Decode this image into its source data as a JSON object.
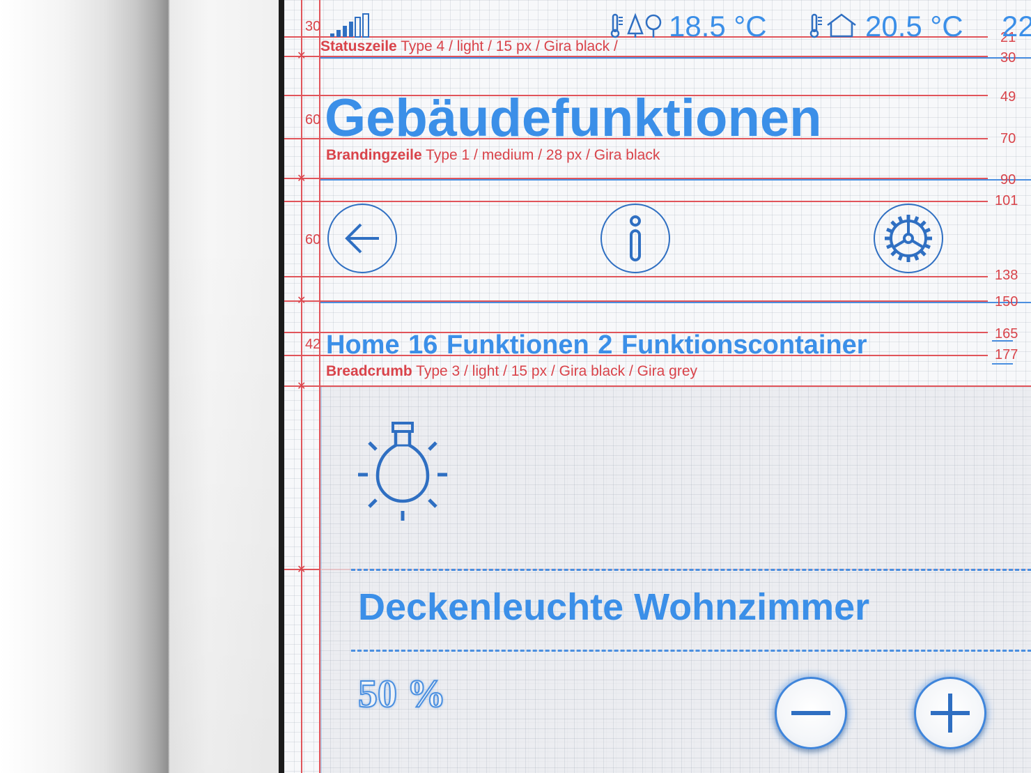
{
  "status_bar": {
    "height_label": "30",
    "outdoor_temp": "18.5 °C",
    "indoor_temp": "20.5 °C",
    "third_value": "22",
    "spec_bold": "Statuszeile",
    "spec_rest": "Type 4 / light / 15 px / Gira black /"
  },
  "branding": {
    "height_label": "60",
    "title": "Gebäudefunktionen",
    "spec_bold": "Brandingzeile",
    "spec_rest": "Type 1 / medium / 28 px / Gira black"
  },
  "nav": {
    "height_label": "60"
  },
  "breadcrumb": {
    "height_label": "42",
    "items": [
      "Home",
      "16 Funktionen",
      "2 Funktionscontainer"
    ],
    "spec_bold": "Breadcrumb",
    "spec_rest": "Type 3 / light / 15 px / Gira black / Gira grey"
  },
  "ruler": [
    "21",
    "30",
    "49",
    "70",
    "90",
    "101",
    "138",
    "150",
    "165",
    "177"
  ],
  "function_tile": {
    "name": "Deckenleuchte Wohnzimmer",
    "value": "50 %"
  },
  "icons": {
    "signal": "signal-strength-icon",
    "outdoor": "thermometer-outdoor-icon",
    "indoor": "thermometer-indoor-icon",
    "back": "arrow-left-icon",
    "info": "info-icon",
    "settings": "gear-icon",
    "light": "lightbulb-icon",
    "minus": "minus-icon",
    "plus": "plus-icon"
  },
  "colors": {
    "accent_blue": "#3b8fe8",
    "guide_red": "#e0545a",
    "icon_dark_blue": "#2f6fc2"
  }
}
